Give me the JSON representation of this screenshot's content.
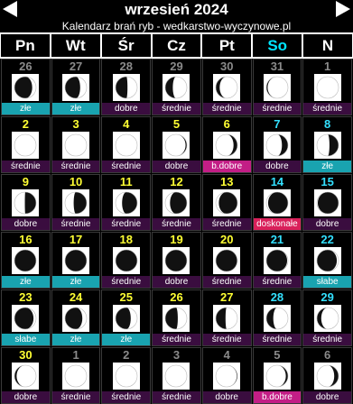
{
  "title": "wrzesień 2024",
  "subtitle": "Kalendarz brań ryb - wedkarstwo-wyczynowe.pl",
  "days": [
    "Pn",
    "Wt",
    "Śr",
    "Cz",
    "Pt",
    "So",
    "N"
  ],
  "cells": [
    {
      "num": "26",
      "tone": "gray",
      "rating": "złe",
      "rk": "zle",
      "phase": 0.82,
      "side": "left"
    },
    {
      "num": "27",
      "tone": "gray",
      "rating": "złe",
      "rk": "zle",
      "phase": 0.7,
      "side": "left"
    },
    {
      "num": "28",
      "tone": "gray",
      "rating": "dobre",
      "rk": "dobre",
      "phase": 0.55,
      "side": "left"
    },
    {
      "num": "29",
      "tone": "gray",
      "rating": "średnie",
      "rk": "srednie",
      "phase": 0.35,
      "side": "left"
    },
    {
      "num": "30",
      "tone": "gray",
      "rating": "średnie",
      "rk": "srednie",
      "phase": 0.18,
      "side": "left"
    },
    {
      "num": "31",
      "tone": "gray",
      "rating": "średnie",
      "rk": "srednie",
      "phase": 0.06,
      "side": "left"
    },
    {
      "num": "1",
      "tone": "gray",
      "rating": "średnie",
      "rk": "srednie",
      "phase": 0.0,
      "side": "left"
    },
    {
      "num": "2",
      "tone": "yellow",
      "rating": "średnie",
      "rk": "srednie",
      "phase": 0.0,
      "side": "right"
    },
    {
      "num": "3",
      "tone": "yellow",
      "rating": "średnie",
      "rk": "srednie",
      "phase": 0.0,
      "side": "right"
    },
    {
      "num": "4",
      "tone": "yellow",
      "rating": "średnie",
      "rk": "srednie",
      "phase": 0.0,
      "side": "right"
    },
    {
      "num": "5",
      "tone": "yellow",
      "rating": "dobre",
      "rk": "dobre",
      "phase": 0.06,
      "side": "right"
    },
    {
      "num": "6",
      "tone": "yellow",
      "rating": "b.dobre",
      "rk": "bdobre",
      "phase": 0.18,
      "side": "right"
    },
    {
      "num": "7",
      "tone": "cyan",
      "rating": "dobre",
      "rk": "dobre",
      "phase": 0.28,
      "side": "right"
    },
    {
      "num": "8",
      "tone": "cyan",
      "rating": "złe",
      "rk": "zle",
      "phase": 0.42,
      "side": "right"
    },
    {
      "num": "9",
      "tone": "yellow",
      "rating": "dobre",
      "rk": "dobre",
      "phase": 0.52,
      "side": "right"
    },
    {
      "num": "10",
      "tone": "yellow",
      "rating": "średnie",
      "rk": "srednie",
      "phase": 0.6,
      "side": "right"
    },
    {
      "num": "11",
      "tone": "yellow",
      "rating": "średnie",
      "rk": "srednie",
      "phase": 0.7,
      "side": "right"
    },
    {
      "num": "12",
      "tone": "yellow",
      "rating": "średnie",
      "rk": "srednie",
      "phase": 0.78,
      "side": "right"
    },
    {
      "num": "13",
      "tone": "yellow",
      "rating": "średnie",
      "rk": "srednie",
      "phase": 0.86,
      "side": "right"
    },
    {
      "num": "14",
      "tone": "cyan",
      "rating": "doskonałe",
      "rk": "doskonale",
      "phase": 0.92,
      "side": "right"
    },
    {
      "num": "15",
      "tone": "cyan",
      "rating": "dobre",
      "rk": "dobre",
      "phase": 0.96,
      "side": "right"
    },
    {
      "num": "16",
      "tone": "yellow",
      "rating": "złe",
      "rk": "zle",
      "phase": 1.0,
      "side": "right"
    },
    {
      "num": "17",
      "tone": "yellow",
      "rating": "złe",
      "rk": "zle",
      "phase": 1.0,
      "side": "right"
    },
    {
      "num": "18",
      "tone": "yellow",
      "rating": "średnie",
      "rk": "srednie",
      "phase": 1.0,
      "side": "right"
    },
    {
      "num": "19",
      "tone": "yellow",
      "rating": "dobre",
      "rk": "dobre",
      "phase": 1.0,
      "side": "right"
    },
    {
      "num": "20",
      "tone": "yellow",
      "rating": "średnie",
      "rk": "srednie",
      "phase": 0.98,
      "side": "left"
    },
    {
      "num": "21",
      "tone": "cyan",
      "rating": "średnie",
      "rk": "srednie",
      "phase": 0.96,
      "side": "left"
    },
    {
      "num": "22",
      "tone": "cyan",
      "rating": "słabe",
      "rk": "slabe",
      "phase": 0.92,
      "side": "left"
    },
    {
      "num": "23",
      "tone": "yellow",
      "rating": "słabe",
      "rk": "slabe",
      "phase": 0.88,
      "side": "left"
    },
    {
      "num": "24",
      "tone": "yellow",
      "rating": "złe",
      "rk": "zle",
      "phase": 0.8,
      "side": "left"
    },
    {
      "num": "25",
      "tone": "yellow",
      "rating": "złe",
      "rk": "zle",
      "phase": 0.7,
      "side": "left"
    },
    {
      "num": "26",
      "tone": "yellow",
      "rating": "średnie",
      "rk": "srednie",
      "phase": 0.58,
      "side": "left"
    },
    {
      "num": "27",
      "tone": "yellow",
      "rating": "średnie",
      "rk": "srednie",
      "phase": 0.45,
      "side": "left"
    },
    {
      "num": "28",
      "tone": "cyan",
      "rating": "średnie",
      "rk": "srednie",
      "phase": 0.32,
      "side": "left"
    },
    {
      "num": "29",
      "tone": "cyan",
      "rating": "średnie",
      "rk": "srednie",
      "phase": 0.2,
      "side": "left"
    },
    {
      "num": "30",
      "tone": "yellow",
      "rating": "dobre",
      "rk": "dobre",
      "phase": 0.1,
      "side": "left"
    },
    {
      "num": "1",
      "tone": "gray",
      "rating": "średnie",
      "rk": "srednie",
      "phase": 0.0,
      "side": "left"
    },
    {
      "num": "2",
      "tone": "gray",
      "rating": "średnie",
      "rk": "srednie",
      "phase": 0.0,
      "side": "right"
    },
    {
      "num": "3",
      "tone": "gray",
      "rating": "średnie",
      "rk": "srednie",
      "phase": 0.0,
      "side": "right"
    },
    {
      "num": "4",
      "tone": "gray",
      "rating": "dobre",
      "rk": "dobre",
      "phase": 0.03,
      "side": "right"
    },
    {
      "num": "5",
      "tone": "gray",
      "rating": "b.dobre",
      "rk": "bdobre",
      "phase": 0.1,
      "side": "right"
    },
    {
      "num": "6",
      "tone": "gray",
      "rating": "dobre",
      "rk": "dobre",
      "phase": 0.2,
      "side": "right"
    }
  ]
}
